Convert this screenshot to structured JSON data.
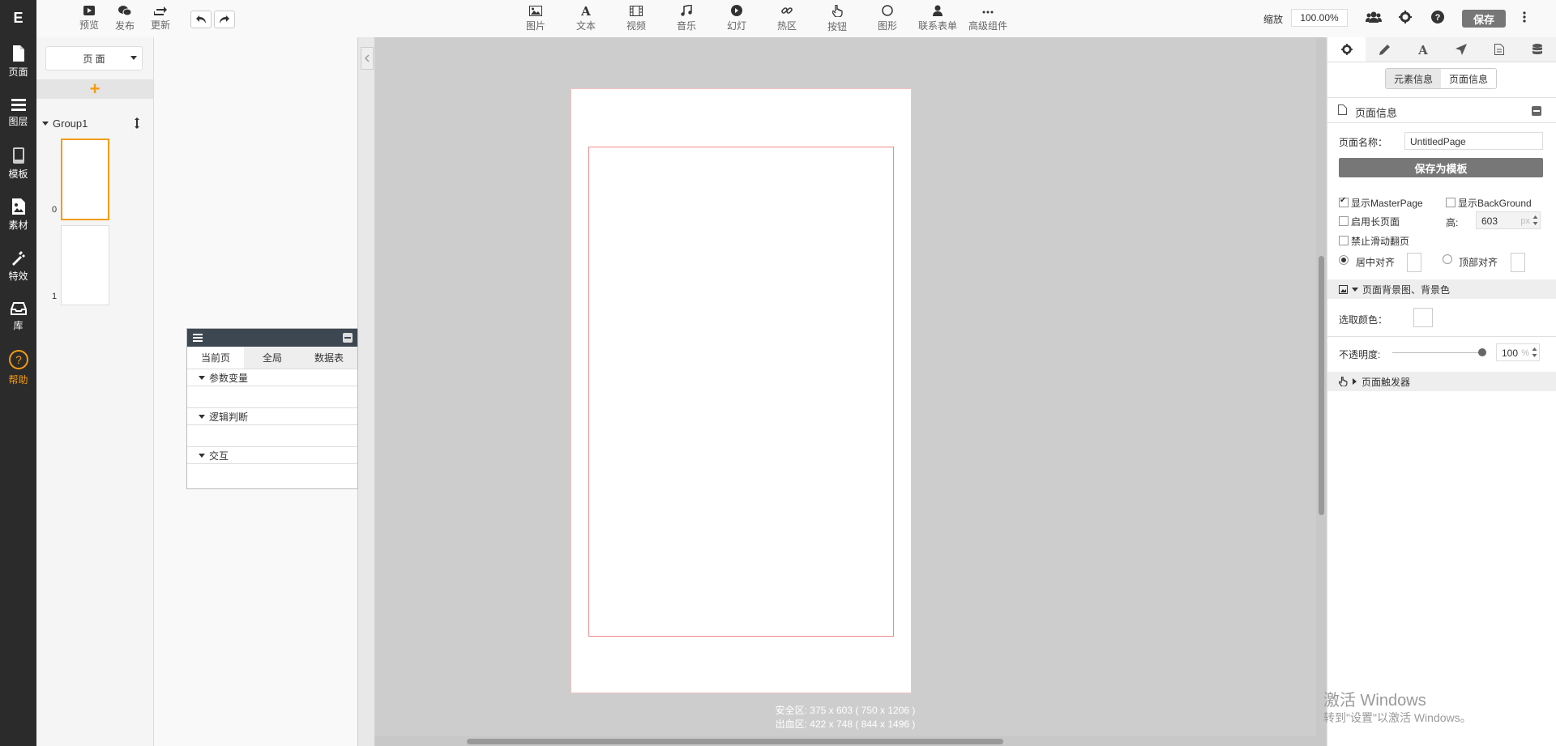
{
  "app": {
    "logo": "E"
  },
  "leftrail": {
    "items": [
      {
        "label": "页面",
        "icon": "file-icon"
      },
      {
        "label": "图层",
        "icon": "layers-icon"
      },
      {
        "label": "模板",
        "icon": "phone-template-icon"
      },
      {
        "label": "素材",
        "icon": "image-asset-icon"
      },
      {
        "label": "特效",
        "icon": "magic-wand-icon"
      },
      {
        "label": "库",
        "icon": "inbox-icon"
      },
      {
        "label": "帮助",
        "icon": "help-circle-icon"
      }
    ]
  },
  "toolbar": {
    "left": [
      {
        "label": "预览",
        "icon": "play-icon"
      },
      {
        "label": "发布",
        "icon": "wechat-icon"
      },
      {
        "label": "更新",
        "icon": "refresh-icon"
      }
    ],
    "center": [
      {
        "label": "图片",
        "icon": "picture-icon"
      },
      {
        "label": "文本",
        "icon": "text-icon"
      },
      {
        "label": "视频",
        "icon": "film-icon"
      },
      {
        "label": "音乐",
        "icon": "music-icon"
      },
      {
        "label": "幻灯",
        "icon": "slideshow-icon"
      },
      {
        "label": "热区",
        "icon": "link-icon"
      },
      {
        "label": "按钮",
        "icon": "hand-pointer-icon"
      },
      {
        "label": "图形",
        "icon": "circle-shape-icon"
      },
      {
        "label": "联系表单",
        "icon": "user-icon"
      },
      {
        "label": "高级组件",
        "icon": "more-dots-icon"
      }
    ],
    "zoom_label": "缩放",
    "zoom_value": "100.00%",
    "save_label": "保存"
  },
  "pages_panel": {
    "select_label": "页 面",
    "group_name": "Group1",
    "pages": [
      "0",
      "1"
    ]
  },
  "var_panel": {
    "tabs": [
      "当前页",
      "全局",
      "数据表"
    ],
    "sections": [
      "参数变量",
      "逻辑判断",
      "交互"
    ]
  },
  "canvas": {
    "safe_info": "安全区: 375 x 603 ( 750 x 1206 )",
    "bleed_info": "出血区: 422 x 748 ( 844 x 1496 )"
  },
  "right_panel": {
    "toggle": [
      "元素信息",
      "页面信息"
    ],
    "section_title": "页面信息",
    "page_name_label": "页面名称：",
    "page_name_value": "UntitledPage",
    "save_template_label": "保存为模板",
    "show_master_label": "显示MasterPage",
    "show_master_checked": true,
    "show_bg_label": "显示BackGround",
    "show_bg_checked": false,
    "long_page_label": "启用长页面",
    "height_label": "高:",
    "height_value": "603",
    "height_unit": "px",
    "no_swipe_label": "禁止滑动翻页",
    "align_center_label": "居中对齐",
    "align_top_label": "顶部对齐",
    "bg_section_label": "页面背景图、背景色",
    "pick_color_label": "选取颜色：",
    "opacity_label": "不透明度:",
    "opacity_value": "100",
    "opacity_unit": "%",
    "trigger_section_label": "页面触发器"
  },
  "watermark": {
    "line1": "激活 Windows",
    "line2": "转到\"设置\"以激活 Windows。"
  },
  "colors": {
    "accent": "#f39c12",
    "rail": "#2b2b2b",
    "save": "#777777"
  }
}
